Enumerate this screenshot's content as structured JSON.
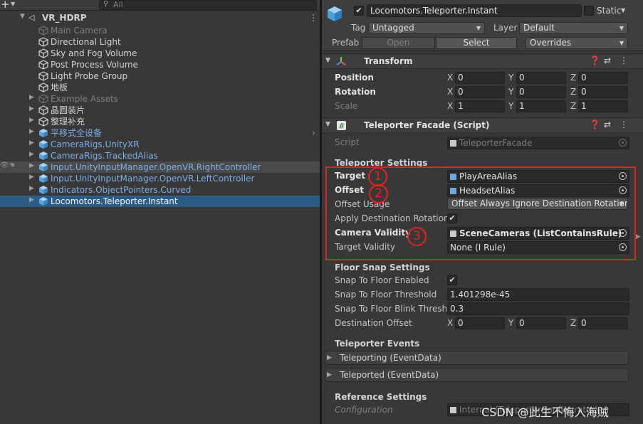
{
  "hierarchy": {
    "search_placeholder": "All",
    "scene_name": "VR_HDRP",
    "items": [
      {
        "label": "Main Camera"
      },
      {
        "label": "Directional Light"
      },
      {
        "label": "Sky and Fog Volume"
      },
      {
        "label": "Post Process Volume"
      },
      {
        "label": "Light Probe Group"
      },
      {
        "label": "地板"
      },
      {
        "label": "Example Assets"
      },
      {
        "label": "晶圆装片"
      },
      {
        "label": "整理补充"
      },
      {
        "label": "平移式全设备"
      },
      {
        "label": "CameraRigs.UnityXR"
      },
      {
        "label": "CameraRigs.TrackedAlias"
      },
      {
        "label": "Input.UnityInputManager.OpenVR.RightController"
      },
      {
        "label": "Input.UnityInputManager.OpenVR.LeftController"
      },
      {
        "label": "Indicators.ObjectPointers.Curved"
      },
      {
        "label": "Locomotors.Teleporter.Instant"
      }
    ]
  },
  "inspector": {
    "object_name": "Locomotors.Teleporter.Instant",
    "static_label": "Static",
    "tag_label": "Tag",
    "tag_value": "Untagged",
    "layer_label": "Layer",
    "layer_value": "Default",
    "prefab_label": "Prefab",
    "open_label": "Open",
    "select_label": "Select",
    "overrides_label": "Overrides",
    "transform": {
      "title": "Transform",
      "position_label": "Position",
      "rotation_label": "Rotation",
      "scale_label": "Scale",
      "axis_x": "X",
      "axis_y": "Y",
      "axis_z": "Z",
      "position": [
        "0",
        "0",
        "0"
      ],
      "rotation": [
        "0",
        "0",
        "0"
      ],
      "scale": [
        "1",
        "1",
        "1"
      ]
    },
    "teleporter": {
      "title": "Teleporter Facade (Script)",
      "script_label": "Script",
      "script_value": "TeleporterFacade",
      "settings_header": "Teleporter Settings",
      "target_label": "Target",
      "target_value": "PlayAreaAlias",
      "offset_label": "Offset",
      "offset_value": "HeadsetAlias",
      "offset_usage_label": "Offset Usage",
      "offset_usage_value": "Offset Always Ignore Destination Rotation",
      "apply_rotation_label": "Apply Destination Rotation",
      "camera_validity_label": "Camera Validity",
      "camera_validity_value": "SceneCameras (ListContainsRule)",
      "target_validity_label": "Target Validity",
      "target_validity_value": "None (I Rule)",
      "floor_snap_header": "Floor Snap Settings",
      "snap_enabled_label": "Snap To Floor Enabled",
      "snap_threshold_label": "Snap To Floor Threshold",
      "snap_threshold_value": "1.401298e-45",
      "blink_label": "Snap To Floor Blink Thresho",
      "blink_value": "0.3",
      "dest_offset_label": "Destination Offset",
      "dest_offset": [
        "0",
        "0",
        "0"
      ],
      "events_header": "Teleporter Events",
      "teleporting_label": "Teleporting (EventData)",
      "teleported_label": "Teleported (EventData)",
      "reference_header": "Reference Settings",
      "configuration_label": "Configuration",
      "configuration_value": "Internal (TeleporterConfigurator)"
    }
  },
  "annotations": {
    "markers": [
      "1",
      "2",
      "3"
    ],
    "color": "#e8211c"
  },
  "watermark": "CSDN @此生不悔入海贼",
  "colors": {
    "selection": "#2c5d87",
    "prefab_text": "#7cafe8",
    "panel_bg": "#383838"
  }
}
